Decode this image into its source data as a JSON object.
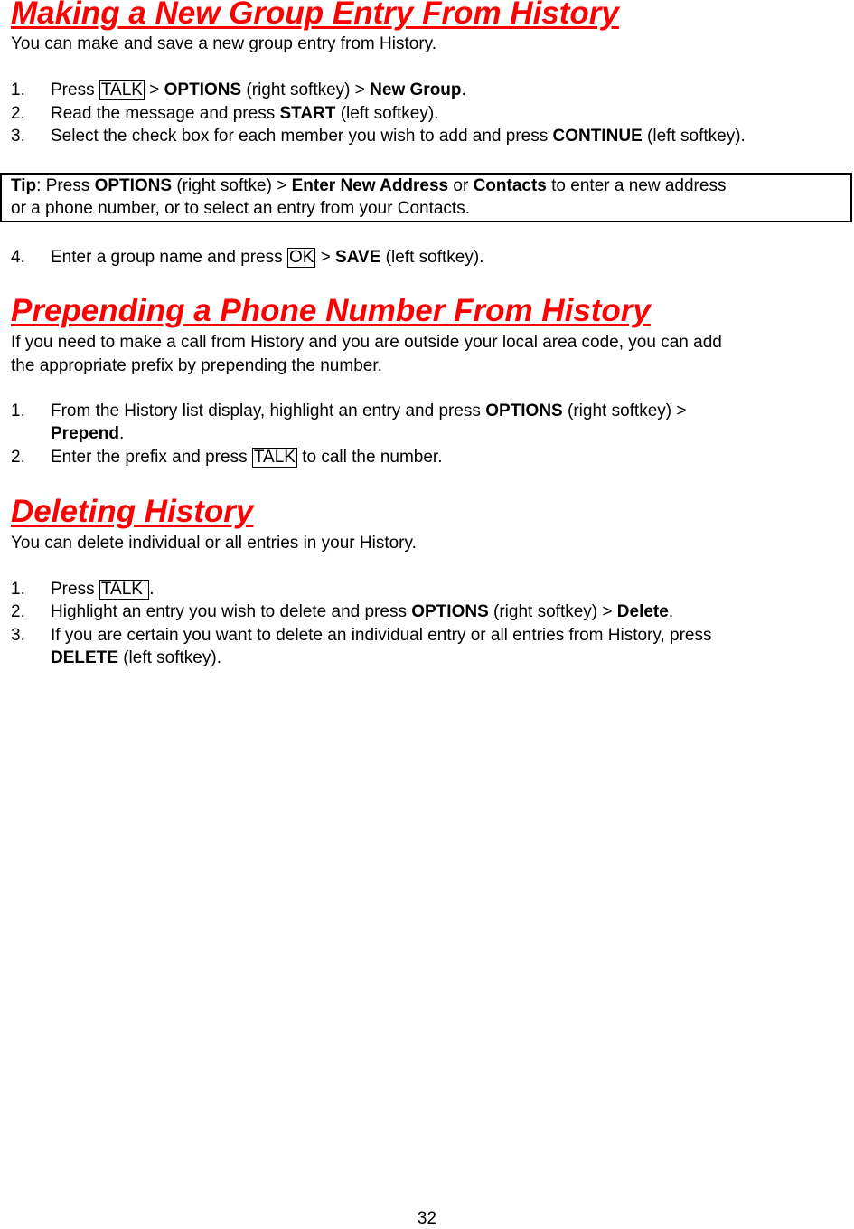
{
  "sections": [
    {
      "title": "Making a New Group Entry From History",
      "intro": "You can make and save a new group entry from History.",
      "steps": [
        {
          "num": "1.",
          "t1": "Press ",
          "key": "TALK",
          "t2": " > ",
          "b1": "OPTIONS",
          "t3": " (right softkey) > ",
          "b2": "New Group",
          "t4": "."
        },
        {
          "num": "2.",
          "t1": "Read the message and press ",
          "b1": "START",
          "t2": " (left softkey)."
        },
        {
          "num": "3.",
          "t1": "Select the check box for each member you wish to add and press ",
          "b1": "CONTINUE",
          "t2": " (left softkey)."
        }
      ],
      "tip": {
        "label": "Tip",
        "t1": ": Press ",
        "b1": "OPTIONS",
        "t2": " (right softke) > ",
        "b2": "Enter New Address",
        "t3": " or ",
        "b3": "Contacts",
        "t4": " to enter a new address",
        "line2": "or a phone number, or to select an entry from your Contacts."
      },
      "step4": {
        "num": "4.",
        "t1": "Enter a group name and press ",
        "key": "OK",
        "t2": " > ",
        "b1": "SAVE",
        "t3": " (left softkey)."
      }
    },
    {
      "title": "Prepending a Phone Number From History",
      "intro_line1": "If you need to make a call from History and you are outside your local area code, you can add",
      "intro_line2": "the appropriate prefix by prepending the number.",
      "steps": [
        {
          "num": "1.",
          "t1": "From the History list display, highlight an entry and press ",
          "b1": "OPTIONS",
          "t2": " (right softkey) >",
          "b2": "Prepend",
          "t3": "."
        },
        {
          "num": "2.",
          "t1": "Enter the prefix and press ",
          "key": "TALK",
          "t2": " to call the number."
        }
      ]
    },
    {
      "title": "Deleting History",
      "intro": "You can delete individual or all entries in your History.",
      "steps": [
        {
          "num": "1.",
          "t1": "Press ",
          "key": "TALK ",
          "t2": "."
        },
        {
          "num": "2.",
          "t1": "Highlight an entry you wish to delete and press ",
          "b1": "OPTIONS",
          "t2": " (right softkey) > ",
          "b2": "Delete",
          "t3": "."
        },
        {
          "num": "3.",
          "t1": "If you are certain you want to delete an individual entry or all entries from History, press",
          "b1": "DELETE",
          "t2": " (left softkey)."
        }
      ]
    }
  ],
  "page_number": "32",
  "colors": {
    "heading": "#ff0000",
    "text": "#000000"
  }
}
